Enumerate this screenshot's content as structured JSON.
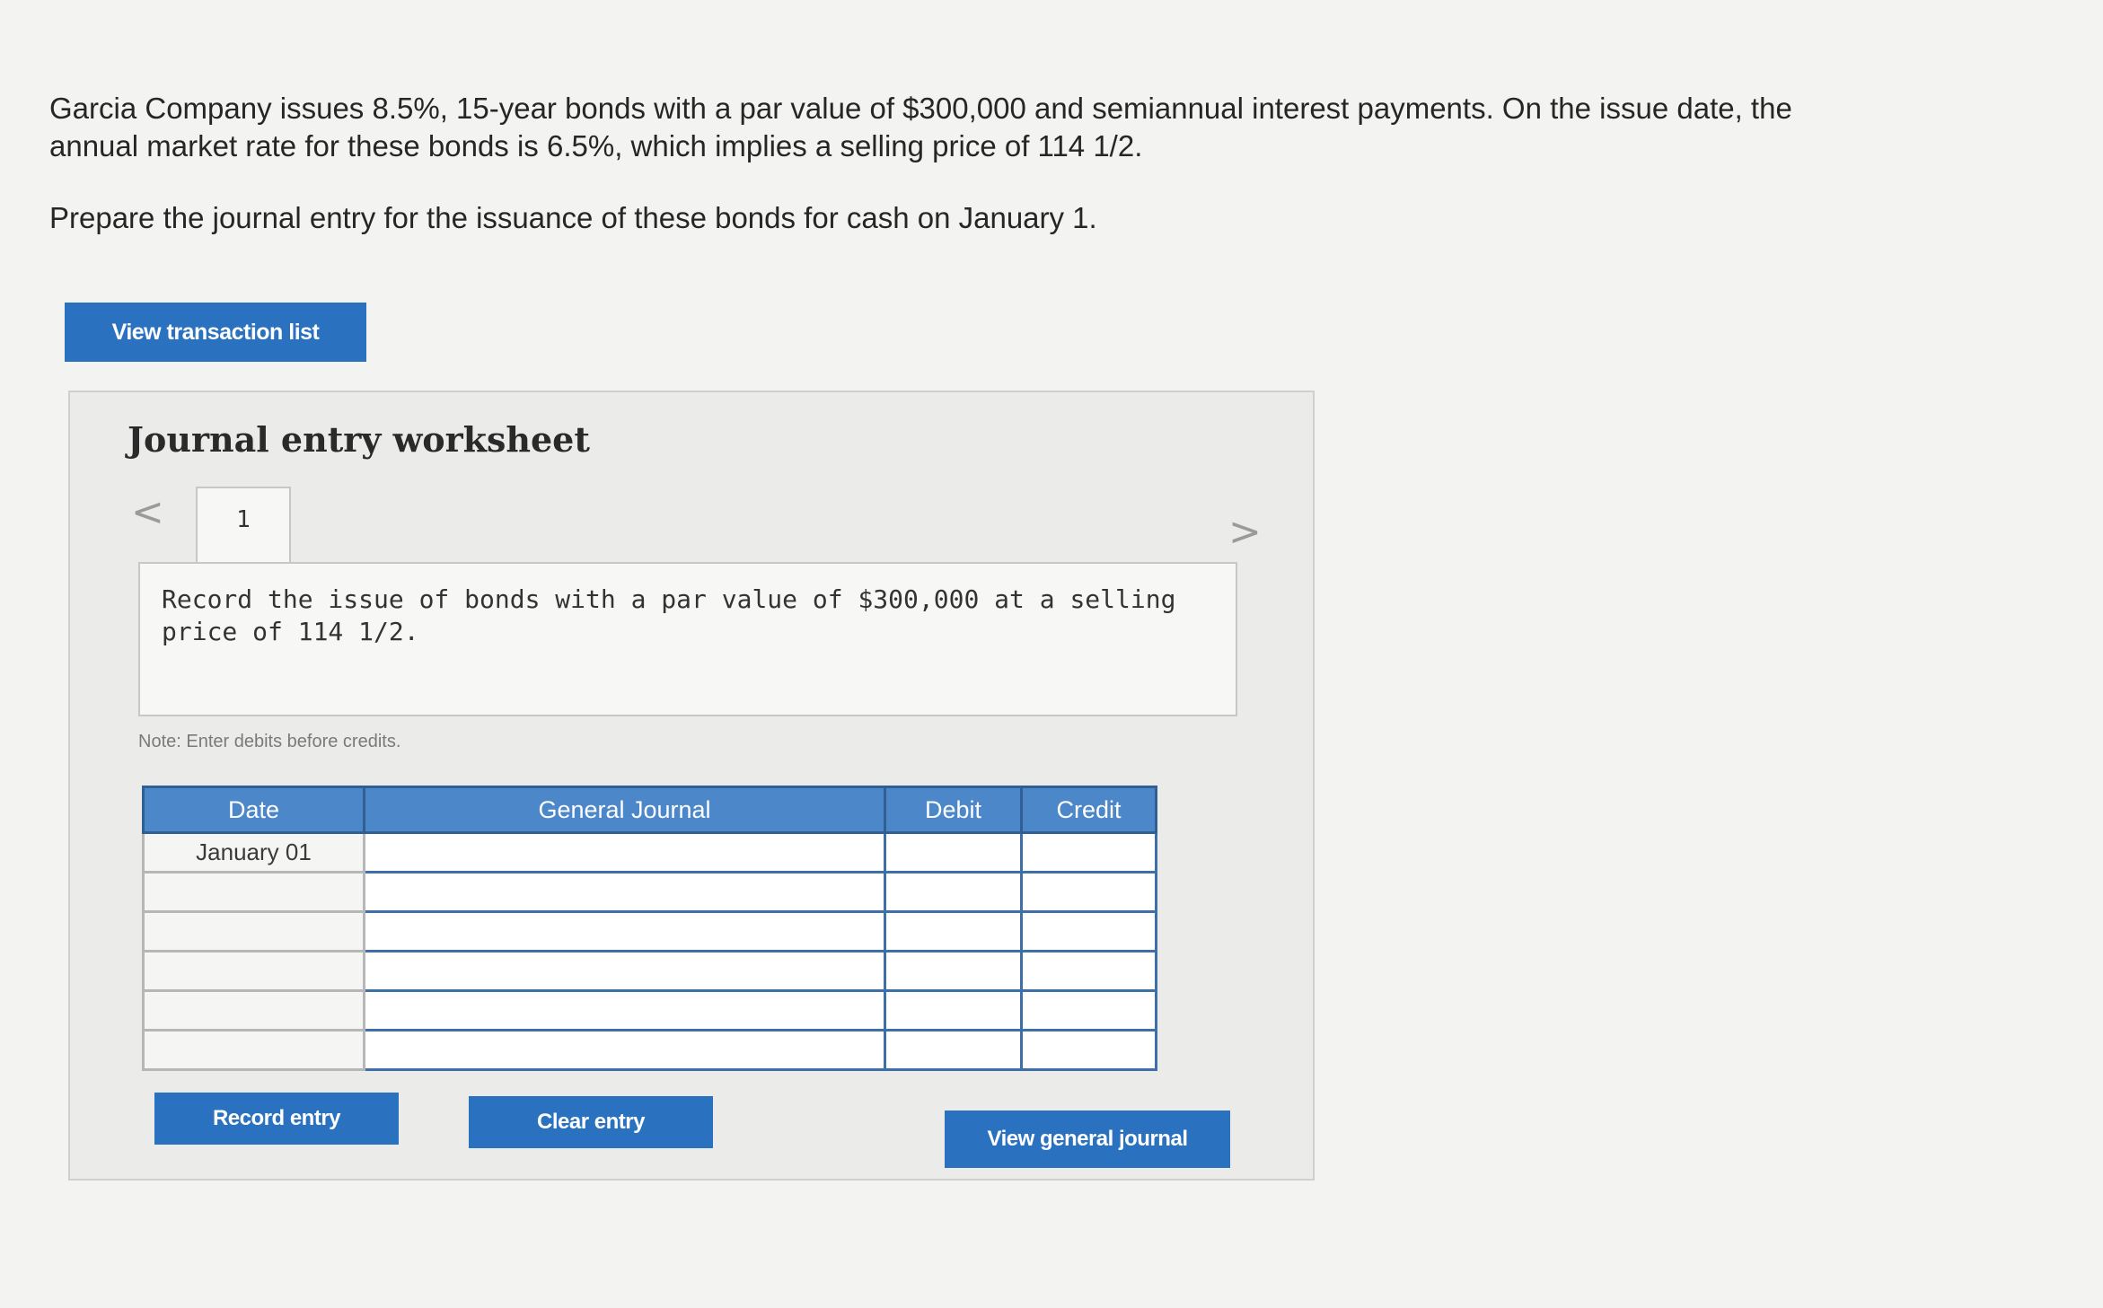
{
  "problem": {
    "statement": "Garcia Company issues 8.5%, 15-year bonds with a par value of $300,000 and semiannual interest payments. On the issue date, the annual market rate for these bonds is 6.5%, which implies a selling price of 114 1/2.",
    "instruction": "Prepare the journal entry for the issuance of these bonds for cash on January 1."
  },
  "buttons": {
    "view_transaction_list": "View transaction list",
    "record_entry": "Record entry",
    "clear_entry": "Clear entry",
    "view_general_journal": "View general journal"
  },
  "worksheet": {
    "title": "Journal entry worksheet",
    "prev_glyph": "<",
    "next_glyph": ">",
    "active_tab": "1",
    "description": "Record the issue of bonds with a par value of $300,000 at a selling price of 114 1/2.",
    "note": "Note: Enter debits before credits."
  },
  "journal": {
    "headers": {
      "date": "Date",
      "general_journal": "General Journal",
      "debit": "Debit",
      "credit": "Credit"
    },
    "rows": [
      {
        "date": "January 01",
        "account": "",
        "debit": "",
        "credit": ""
      },
      {
        "date": "",
        "account": "",
        "debit": "",
        "credit": ""
      },
      {
        "date": "",
        "account": "",
        "debit": "",
        "credit": ""
      },
      {
        "date": "",
        "account": "",
        "debit": "",
        "credit": ""
      },
      {
        "date": "",
        "account": "",
        "debit": "",
        "credit": ""
      },
      {
        "date": "",
        "account": "",
        "debit": "",
        "credit": ""
      }
    ]
  },
  "colors": {
    "accent": "#2a72c0",
    "table_header": "#4b87c9",
    "table_border": "#3d6fa8"
  }
}
